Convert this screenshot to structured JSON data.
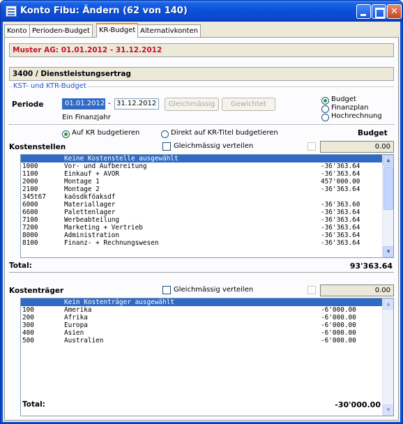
{
  "window": {
    "title": "Konto Fibu: Ändern (62 von 140)"
  },
  "tabs": [
    "Konto",
    "Perioden-Budget",
    "KR-Budget",
    "Alternativkonten"
  ],
  "header": {
    "company_period": "Muster AG: 01.01.2012 - 31.12.2012",
    "account": "3400 / Dienstleistungsertrag"
  },
  "budget_group": {
    "title": "KST- und KTR-Budget",
    "periode_label": "Periode",
    "date_from": "01.01.2012",
    "separator": "-",
    "date_to": "31.12.2012",
    "hint": "Ein Finanzjahr",
    "btn_gleichmaessig": "Gleichmässig",
    "btn_gewichtet": "Gewichtet",
    "type_options": [
      "Budget",
      "Finanzplan",
      "Hochrechnung"
    ],
    "type_selected": "Budget"
  },
  "mode": {
    "option_kr": "Auf KR budgetieren",
    "option_titel": "Direkt auf KR-Titel budgetieren",
    "selected": "Auf KR budgetieren",
    "budget_header": "Budget"
  },
  "kostenstellen": {
    "title": "Kostenstellen",
    "distribute_label": "Gleichmässig verteilen",
    "value": "0.00",
    "rows": [
      {
        "code": "",
        "name": "Keine Kostenstelle ausgewählt",
        "amount": "",
        "selected": true
      },
      {
        "code": "1000",
        "name": "Vor- und Aufbereitung",
        "amount": "-36'363.64"
      },
      {
        "code": "1100",
        "name": "Einkauf + AVOR",
        "amount": "-36'363.64"
      },
      {
        "code": "2000",
        "name": "Montage 1",
        "amount": "457'000.00"
      },
      {
        "code": "2100",
        "name": "Montage 2",
        "amount": "-36'363.64"
      },
      {
        "code": "345t67",
        "name": "kaösdkföaksdf",
        "amount": ""
      },
      {
        "code": "6000",
        "name": "Materiallager",
        "amount": "-36'363.60"
      },
      {
        "code": "6600",
        "name": "Palettenlager",
        "amount": "-36'363.64"
      },
      {
        "code": "7100",
        "name": "Werbeabteilung",
        "amount": "-36'363.64"
      },
      {
        "code": "7200",
        "name": "Marketing + Vertrieb",
        "amount": "-36'363.64"
      },
      {
        "code": "8000",
        "name": "Administration",
        "amount": "-36'363.64"
      },
      {
        "code": "8100",
        "name": "Finanz- + Rechnungswesen",
        "amount": "-36'363.64"
      }
    ],
    "total_label": "Total:",
    "total_value": "93'363.64"
  },
  "kostentraeger": {
    "title": "Kostenträger",
    "distribute_label": "Gleichmässig verteilen",
    "value": "0.00",
    "rows": [
      {
        "code": "",
        "name": "Kein Kostenträger ausgewählt",
        "amount": "",
        "selected": true
      },
      {
        "code": "100",
        "name": "Amerika",
        "amount": "-6'000.00"
      },
      {
        "code": "200",
        "name": "Afrika",
        "amount": "-6'000.00"
      },
      {
        "code": "300",
        "name": "Europa",
        "amount": "-6'000.00"
      },
      {
        "code": "400",
        "name": "Asien",
        "amount": "-6'000.00"
      },
      {
        "code": "500",
        "name": "Australien",
        "amount": "-6'000.00"
      }
    ],
    "total_label": "Total:",
    "total_value": "-30'000.00"
  }
}
